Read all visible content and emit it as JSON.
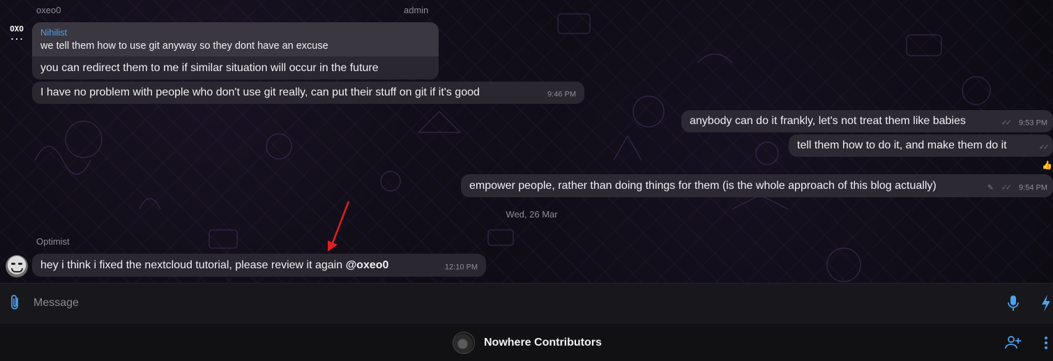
{
  "top_senders": {
    "left": "oxeo0",
    "right": "admin"
  },
  "avatar_oxo": {
    "line1": "OXO",
    "line2": "..."
  },
  "reply_quote": {
    "name": "Nihilist",
    "text": "we tell them how to use git anyway so they dont have an excuse"
  },
  "messages": [
    {
      "id": "m1",
      "direction": "incoming",
      "text": "you can redirect them to me if similar situation will occur in the future",
      "time": ""
    },
    {
      "id": "m2",
      "direction": "incoming",
      "text": "I have no problem with people who don't use git really, can put their stuff on git if it's good",
      "time": "9:46 PM"
    },
    {
      "id": "m3",
      "direction": "outgoing",
      "text": "anybody can do it frankly, let's not treat them like babies",
      "time": "9:53 PM"
    },
    {
      "id": "m4",
      "direction": "outgoing",
      "text": "tell them how to do it, and make them do it",
      "time": ""
    },
    {
      "id": "m5",
      "direction": "outgoing",
      "text": "empower people, rather than doing things for them  (is the whole approach of this blog actually)",
      "time": "9:54 PM"
    }
  ],
  "date_separator": "Wed, 26 Mar",
  "last_message": {
    "sender": "Optimist",
    "text": "hey i think i fixed the nextcloud tutorial, please review it again ",
    "mention": "@oxeo0",
    "time": "12:10 PM"
  },
  "reaction_icon": "thumbs-up",
  "composer": {
    "placeholder": "Message"
  },
  "bottom_bar": {
    "group_name": "Nowhere Contributors"
  },
  "colors": {
    "accent": "#4ea1f0",
    "bubble": "#2a2730",
    "arrow": "#e02020"
  }
}
